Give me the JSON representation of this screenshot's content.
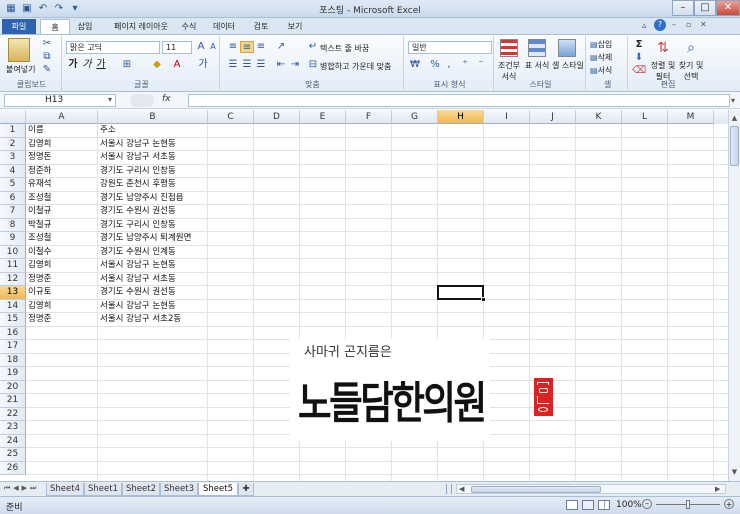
{
  "window": {
    "title": "포스팅 - Microsoft Excel"
  },
  "tabs": [
    "파일",
    "홈",
    "삽입",
    "페이지 레이아웃",
    "수식",
    "데이터",
    "검토",
    "보기"
  ],
  "ribbon": {
    "clipboard": {
      "label": "클립보드",
      "paste": "붙여넣기"
    },
    "font": {
      "label": "글꼴",
      "name": "맑은 고딕",
      "size": "11",
      "bold": "가",
      "italic": "가",
      "underline": "가"
    },
    "alignment": {
      "label": "맞춤",
      "wrap": "텍스트 줄 바꿈",
      "merge": "병합하고 가운데 맞춤"
    },
    "number": {
      "label": "표시 형식",
      "format": "일반"
    },
    "styles": {
      "label": "스타일",
      "conditional": "조건부 서식",
      "table": "표 서식",
      "cell": "셀 스타일"
    },
    "cells": {
      "label": "셀",
      "insert": "삽입",
      "delete": "삭제",
      "format": "서식"
    },
    "editing": {
      "label": "편집",
      "sort": "정렬 및 필터",
      "find": "찾기 및 선택"
    }
  },
  "formula_bar": {
    "name_box": "H13",
    "fx": "fx",
    "formula": ""
  },
  "columns": [
    "A",
    "B",
    "C",
    "D",
    "E",
    "F",
    "G",
    "H",
    "I",
    "J",
    "K",
    "L",
    "M"
  ],
  "selected_column": "H",
  "selected_row": 13,
  "rows": [
    [
      "이름",
      "주소"
    ],
    [
      "김영희",
      "서울시 강남구 논현동"
    ],
    [
      "정명돈",
      "서울시 강남구 서초동"
    ],
    [
      "정준하",
      "경기도 구리시 인창동"
    ],
    [
      "유재석",
      "강원도 춘천시 후평동"
    ],
    [
      "조성철",
      "경기도 남양주시 진접읍"
    ],
    [
      "이철규",
      "경기도 수원시 권선동"
    ],
    [
      "박철규",
      "경기도 구리시 인창동"
    ],
    [
      "조성철",
      "경기도 남양주시 퇴계원면"
    ],
    [
      "이철수",
      "경기도 수원시 인계동"
    ],
    [
      "김영희",
      "서울시 강남구 논현동"
    ],
    [
      "정명준",
      "서울시 강남구 서초동"
    ],
    [
      "이규토",
      "경기도 수원시 권선동"
    ],
    [
      "김영희",
      "서울시 강남구 논현동"
    ],
    [
      "정명준",
      "서울시 강남구 서초2동"
    ]
  ],
  "row_numbers": [
    1,
    2,
    3,
    4,
    5,
    6,
    7,
    8,
    9,
    10,
    11,
    12,
    13,
    14,
    15,
    16,
    17,
    18,
    19,
    20,
    21,
    22,
    23,
    24,
    25,
    26
  ],
  "overlay": {
    "subtitle": "사마귀 곤지름은",
    "title": "노들담한의원"
  },
  "sheets": [
    "Sheet4",
    "Sheet1",
    "Sheet2",
    "Sheet3",
    "Sheet5"
  ],
  "active_sheet": "Sheet5",
  "status": {
    "mode": "준비",
    "zoom": "100%"
  }
}
